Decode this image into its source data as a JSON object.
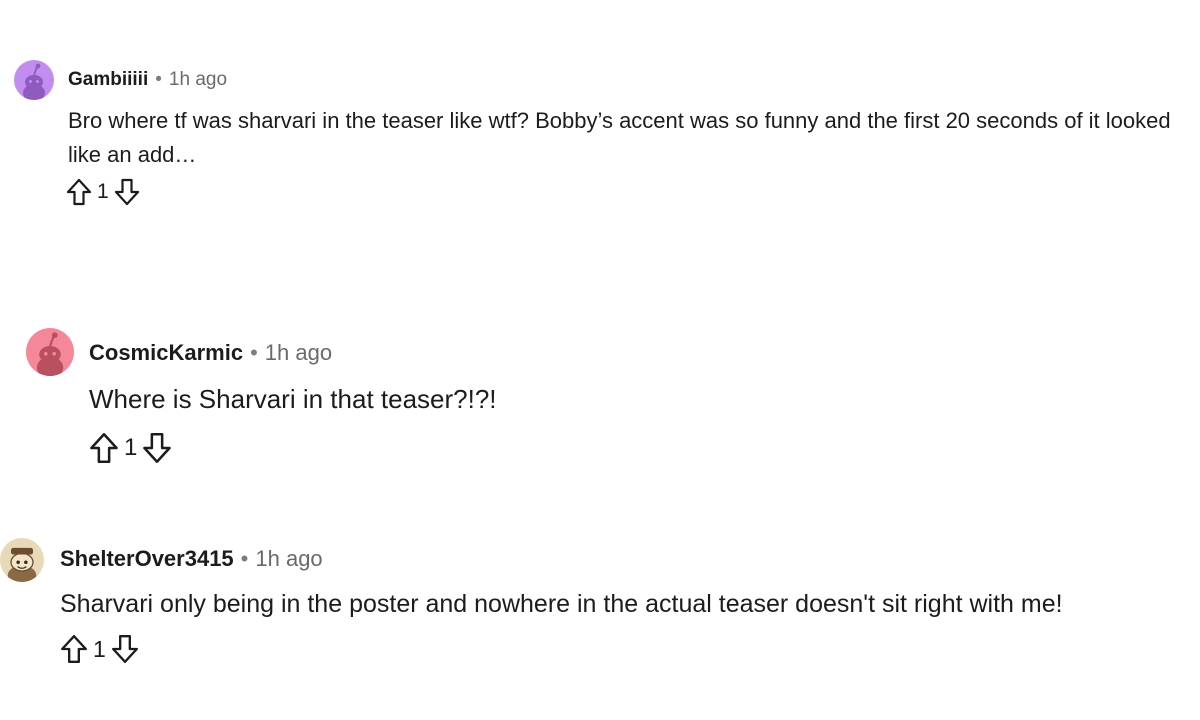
{
  "comments": [
    {
      "username": "Gambiiiii",
      "separator": "•",
      "time": "1h ago",
      "body": "Bro where tf was sharvari in the teaser like wtf? Bobby’s accent was so funny and the first 20 seconds of it looked like an add…",
      "score": "1",
      "avatar_color": "#c18ef0",
      "avatar_icon": "reddit-snoo-icon"
    },
    {
      "username": "CosmicKarmic",
      "separator": "•",
      "time": "1h ago",
      "body": "Where is Sharvari in that teaser?!?!",
      "score": "1",
      "avatar_color": "#f4879a",
      "avatar_icon": "reddit-snoo-icon"
    },
    {
      "username": "ShelterOver3415",
      "separator": "•",
      "time": "1h ago",
      "body": "Sharvari only being in the poster and nowhere in the actual teaser doesn't sit right with me!",
      "score": "1",
      "avatar_color": "#e8d9b8",
      "avatar_icon": "custom-snoo-avatar-icon"
    }
  ]
}
